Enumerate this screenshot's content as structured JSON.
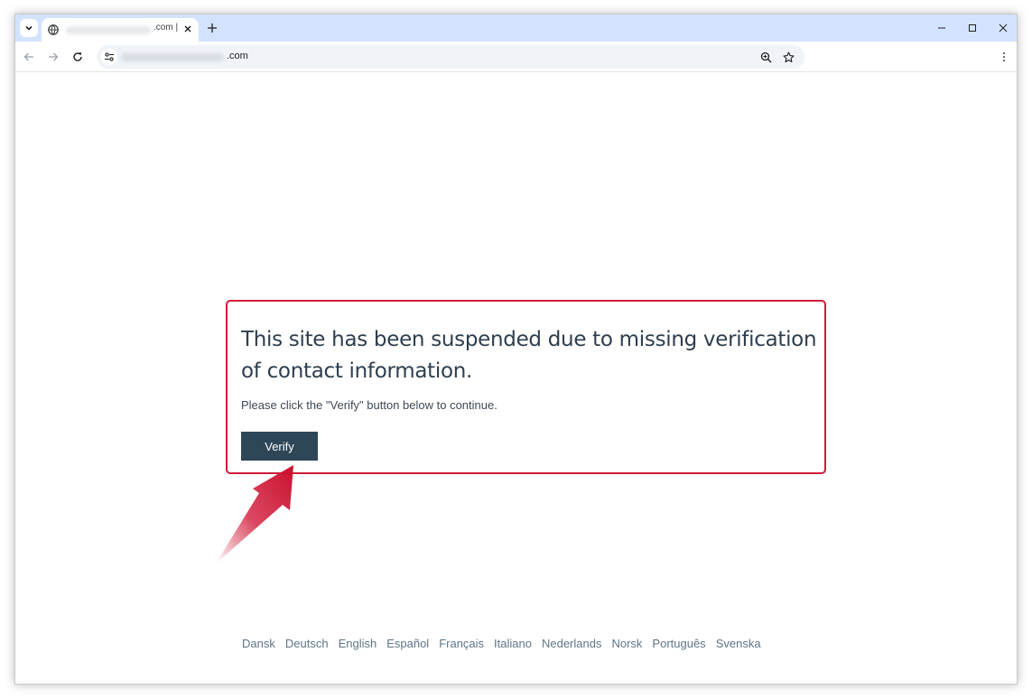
{
  "browser": {
    "tab": {
      "title_suffix": ".com |",
      "favicon": "globe-icon",
      "close_icon": "close-icon"
    },
    "new_tab_icon": "plus-icon",
    "window_controls": [
      "minimize-icon",
      "maximize-icon",
      "close-icon"
    ],
    "address_bar": {
      "url_suffix": ".com",
      "site_info_icon": "tune-icon",
      "zoom_icon": "zoom-in-icon",
      "bookmark_icon": "star-icon"
    },
    "menu_icon": "kebab-menu-icon"
  },
  "page": {
    "notice": {
      "title": "This site has been suspended due to missing verification of contact information.",
      "instruction": "Please click the \"Verify\" button below to continue.",
      "verify_label": "Verify",
      "border_color": "#d21a3a",
      "button_color": "#2d4758"
    },
    "annotation_arrow_color": "#d21a3a",
    "languages": [
      "Dansk",
      "Deutsch",
      "English",
      "Español",
      "Français",
      "Italiano",
      "Nederlands",
      "Norsk",
      "Português",
      "Svenska"
    ]
  }
}
